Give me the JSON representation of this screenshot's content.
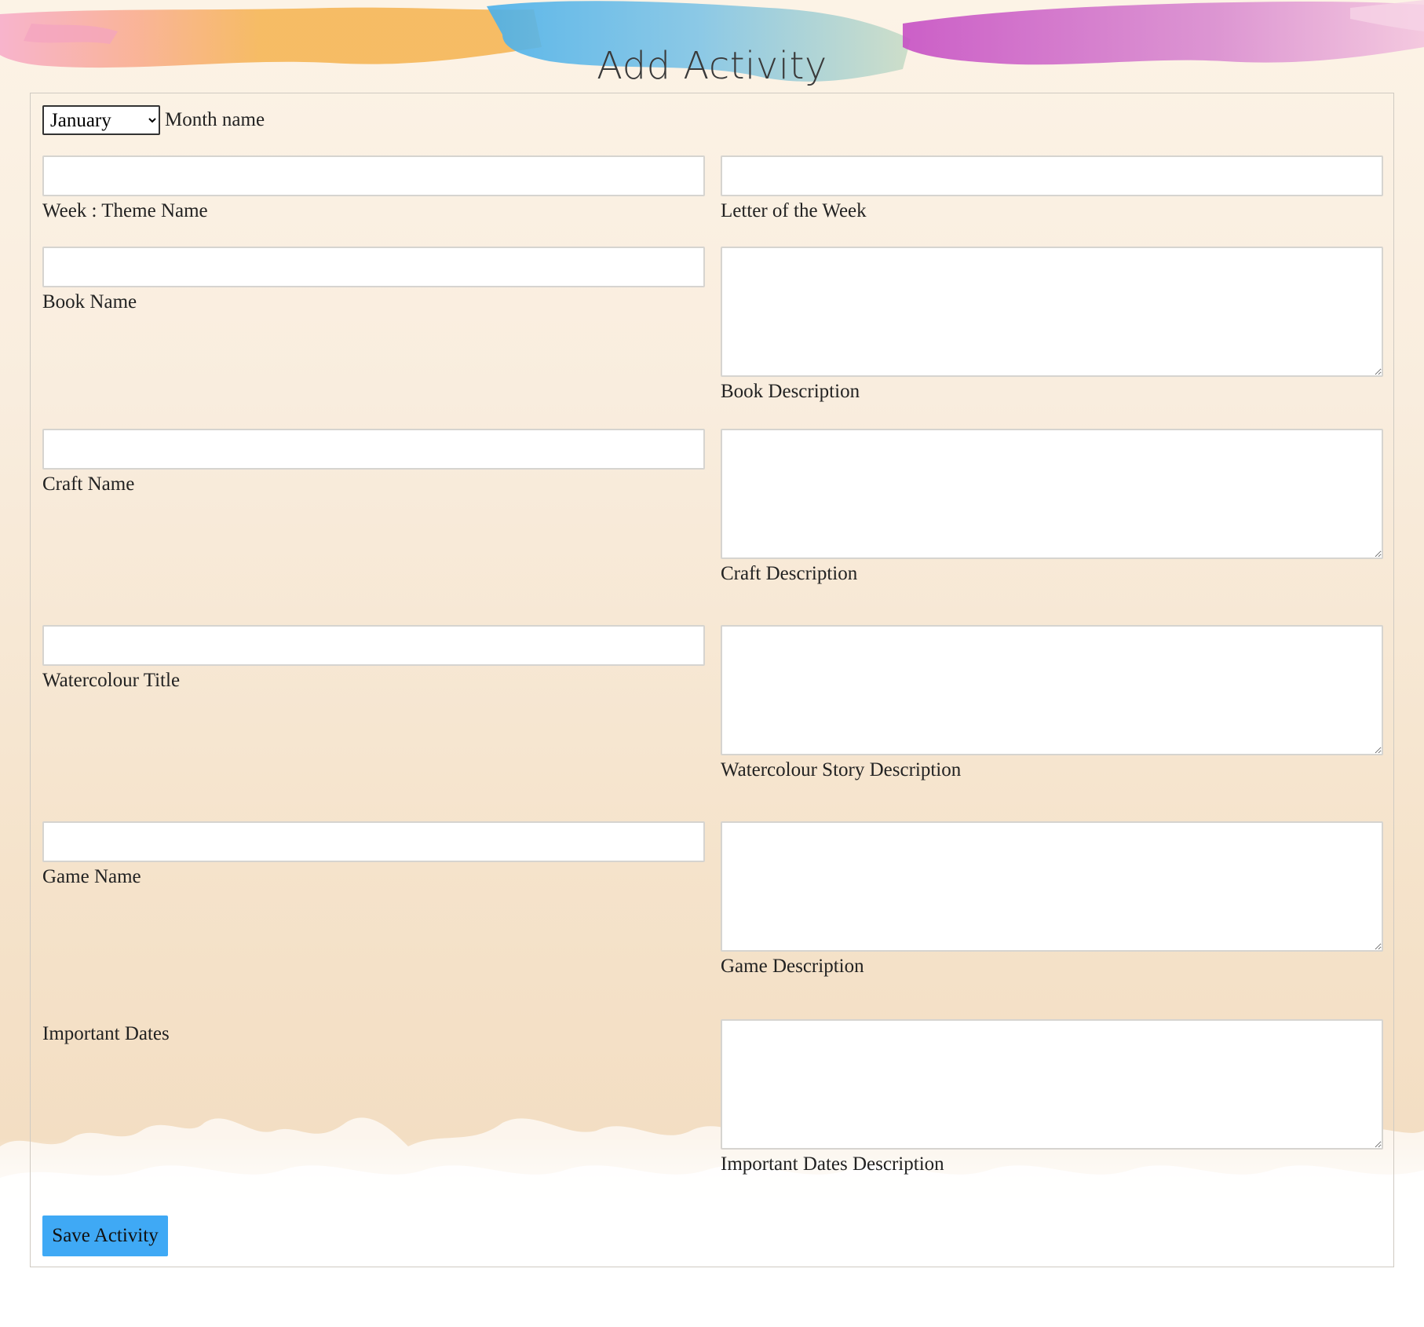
{
  "page": {
    "title": "Add Activity"
  },
  "form": {
    "month": {
      "selected": "January",
      "options": [
        "January"
      ],
      "label": "Month name"
    },
    "fields": {
      "week_theme": {
        "label": "Week : Theme Name",
        "value": ""
      },
      "letter_of_week": {
        "label": "Letter of the Week",
        "value": ""
      },
      "book_name": {
        "label": "Book Name",
        "value": ""
      },
      "book_description": {
        "label": "Book Description",
        "value": ""
      },
      "craft_name": {
        "label": "Craft Name",
        "value": ""
      },
      "craft_description": {
        "label": "Craft Description",
        "value": ""
      },
      "watercolour_title": {
        "label": "Watercolour Title",
        "value": ""
      },
      "watercolour_story_description": {
        "label": "Watercolour Story Description",
        "value": ""
      },
      "game_name": {
        "label": "Game Name",
        "value": ""
      },
      "game_description": {
        "label": "Game Description",
        "value": ""
      },
      "important_dates": {
        "label": "Important Dates"
      },
      "important_dates_description": {
        "label": "Important Dates Description",
        "value": ""
      }
    },
    "submit": {
      "label": "Save Activity"
    }
  },
  "colors": {
    "button": "#3fa9f5",
    "panel_border": "#cfcac2",
    "background": "#f9edde"
  }
}
